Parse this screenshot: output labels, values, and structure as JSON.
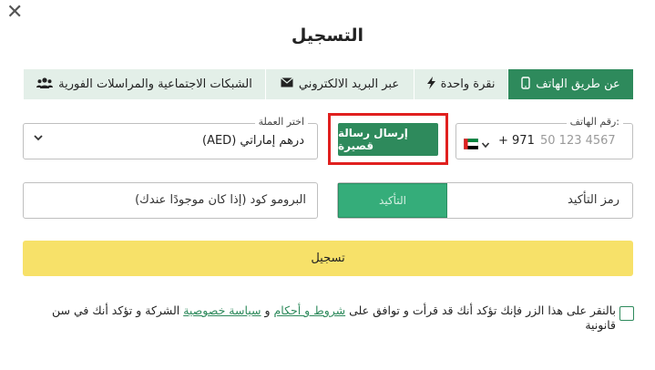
{
  "dialog": {
    "title": "التسجيل",
    "close_glyph": "✕"
  },
  "tabs": [
    {
      "label": "عن طريق الهاتف",
      "icon": "phone-icon",
      "glyph": "▯",
      "active": true
    },
    {
      "label": "نقرة واحدة",
      "icon": "lightning-icon",
      "glyph": "⚡",
      "active": false
    },
    {
      "label": "عبر البريد الالكتروني",
      "icon": "envelope-icon",
      "glyph": "✉",
      "active": false
    },
    {
      "label": "الشبكات الاجتماعية والمراسلات الفورية",
      "icon": "users-icon",
      "glyph": "👥",
      "active": false
    }
  ],
  "phone": {
    "legend": "رقم الهاتف:",
    "code": "+ 971",
    "placeholder": "50 123 4567",
    "country_flag": "uae-flag-icon",
    "chevron": "˅"
  },
  "sms_button": {
    "label": "إرسال رسالة قصيرة"
  },
  "currency": {
    "legend": "اختر العملة",
    "value": "درهم إماراتي (AED)",
    "chevron": "˅"
  },
  "confirm_code": {
    "placeholder": "رمز التأكيد",
    "button_label": "التأكيد"
  },
  "promo": {
    "placeholder": "البرومو كود (إذا كان موجودًا عندك)"
  },
  "register_button": {
    "label": "تسجيل"
  },
  "terms": {
    "part1": "بالنقر على هذا الزر فإنك تؤكد أنك قد قرأت و توافق على ",
    "link_terms": "شروط و أحكام",
    "part2": " و ",
    "link_privacy": "سياسة خصوصية",
    "part3": " الشركة و تؤكد أنك في سن قانونية"
  },
  "colors": {
    "primary": "#2e8a5c",
    "tab_inactive": "#e3efe8",
    "confirm": "#35ad7a",
    "register": "#f7e169",
    "highlight": "#e0201f"
  }
}
